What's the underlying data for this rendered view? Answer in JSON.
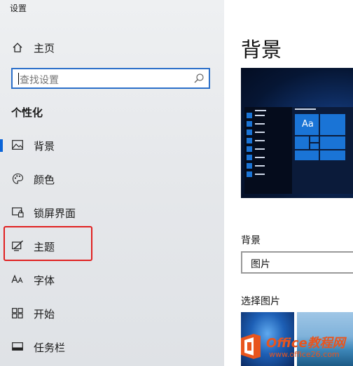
{
  "app_title": "设置",
  "home_label": "主页",
  "search": {
    "placeholder": "查找设置"
  },
  "section_title": "个性化",
  "nav": [
    {
      "label": "背景",
      "icon": "picture-icon",
      "active": true
    },
    {
      "label": "颜色",
      "icon": "palette-icon"
    },
    {
      "label": "锁屏界面",
      "icon": "lockscreen-icon"
    },
    {
      "label": "主题",
      "icon": "theme-brush-icon",
      "highlighted": true
    },
    {
      "label": "字体",
      "icon": "font-icon"
    },
    {
      "label": "开始",
      "icon": "start-grid-icon"
    },
    {
      "label": "任务栏",
      "icon": "taskbar-icon"
    }
  ],
  "main": {
    "title": "背景",
    "preview_tile_text": "Aa",
    "background_label": "背景",
    "background_value": "图片",
    "choose_picture_label": "选择图片"
  },
  "watermark": {
    "brand": "Office教程网",
    "url": "www.office26.com"
  },
  "colors": {
    "accent": "#0a64d8",
    "search_border": "#2b6fc9",
    "highlight_box": "#e02020"
  }
}
